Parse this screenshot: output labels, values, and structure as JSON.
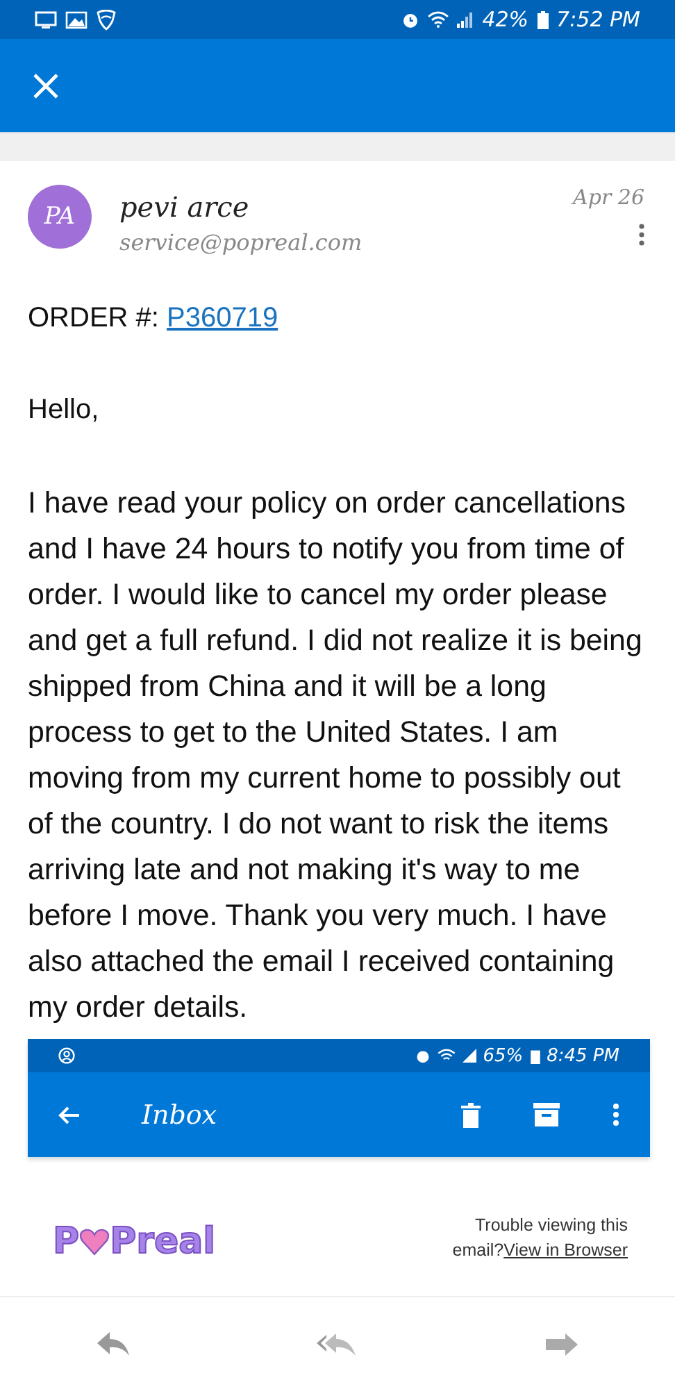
{
  "status_bar": {
    "battery": "42%",
    "time": "7:52 PM"
  },
  "sender": {
    "initials": "PA",
    "name": "pevi arce",
    "email": "service@popreal.com",
    "date": "Apr 26"
  },
  "body": {
    "order_label": "ORDER #:",
    "order_number": "P360719",
    "greeting": "Hello,",
    "message": "I have read your policy on order cancellations and I have 24 hours to notify you from time of order. I would like to cancel my order please and get a full refund. I did not realize it is being shipped from China and it will be a long process to get to the United States. I am moving from my current home to possibly out of the country. I do not want to risk the items arriving late and not making it's way to me before I move. Thank you very much. I have also attached the email I received containing my order details."
  },
  "attachment": {
    "status_bar": {
      "battery": "65%",
      "time": "8:45 PM"
    },
    "title": "Inbox",
    "logo": {
      "before": "P",
      "after": "Preal"
    },
    "trouble_text": "Trouble viewing this email?",
    "link": "View in Browser"
  }
}
